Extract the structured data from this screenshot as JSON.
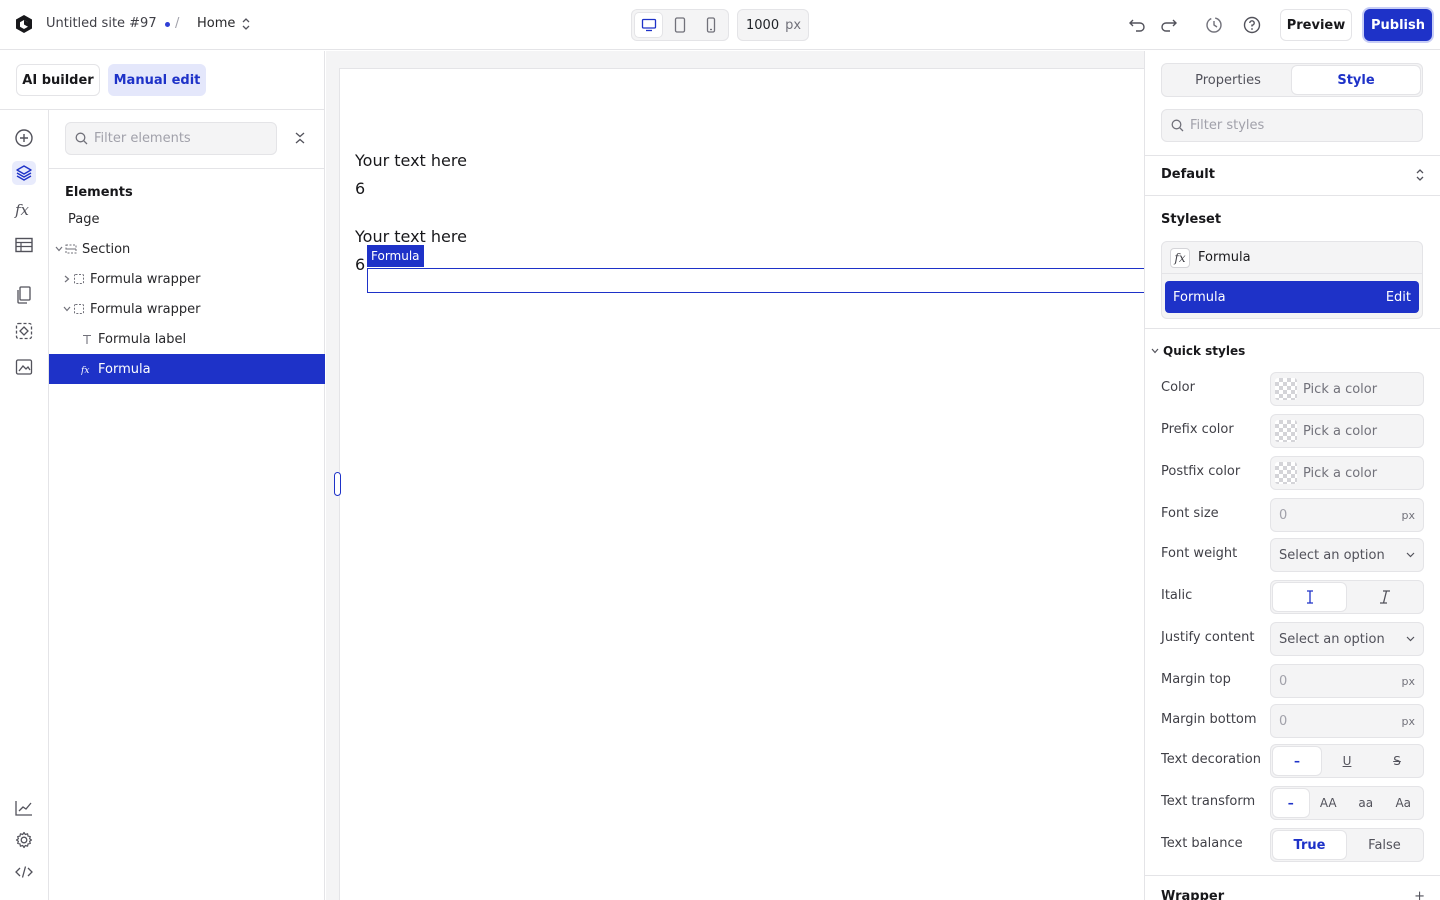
{
  "topbar": {
    "site_title": "Untitled site #97",
    "separator": "/",
    "page_name": "Home",
    "width_value": "1000",
    "width_unit": "px",
    "preview_label": "Preview",
    "publish_label": "Publish"
  },
  "mode": {
    "ai_builder": "AI builder",
    "manual_edit": "Manual edit"
  },
  "elements_panel": {
    "filter_placeholder": "Filter elements",
    "heading": "Elements",
    "tree": [
      {
        "label": "Page"
      },
      {
        "label": "Section"
      },
      {
        "label": "Formula wrapper"
      },
      {
        "label": "Formula wrapper"
      },
      {
        "label": "Formula label"
      },
      {
        "label": "Formula"
      }
    ]
  },
  "canvas": {
    "text1": "Your text here",
    "value1": "6",
    "text2": "Your text here",
    "value2": "6",
    "selection_tag": "Formula"
  },
  "style_panel": {
    "tabs": [
      "Properties",
      "Style"
    ],
    "filter_placeholder": "Filter styles",
    "state": "Default",
    "styleset_heading": "Styleset",
    "styleset_name": "Formula",
    "styleset_selected": "Formula",
    "edit_label": "Edit",
    "quick_styles_heading": "Quick styles",
    "props": {
      "color": {
        "label": "Color",
        "value": "Pick a color"
      },
      "prefix_color": {
        "label": "Prefix color",
        "value": "Pick a color"
      },
      "postfix_color": {
        "label": "Postfix color",
        "value": "Pick a color"
      },
      "font_size": {
        "label": "Font size",
        "placeholder": "0",
        "unit": "px"
      },
      "font_weight": {
        "label": "Font weight",
        "value": "Select an option"
      },
      "italic": {
        "label": "Italic"
      },
      "justify_content": {
        "label": "Justify content",
        "value": "Select an option"
      },
      "margin_top": {
        "label": "Margin top",
        "placeholder": "0",
        "unit": "px"
      },
      "margin_bottom": {
        "label": "Margin bottom",
        "placeholder": "0",
        "unit": "px"
      },
      "text_decoration": {
        "label": "Text decoration",
        "options": [
          "–",
          "U",
          "S"
        ]
      },
      "text_transform": {
        "label": "Text transform",
        "options": [
          "–",
          "AA",
          "aa",
          "Aa"
        ]
      },
      "text_balance": {
        "label": "Text balance",
        "options": [
          "True",
          "False"
        ]
      }
    },
    "wrapper_heading": "Wrapper",
    "wrapper_add": "+"
  },
  "colors": {
    "accent": "#1e32c8",
    "border": "#e4e4e7",
    "control_bg": "#f4f4f5"
  }
}
